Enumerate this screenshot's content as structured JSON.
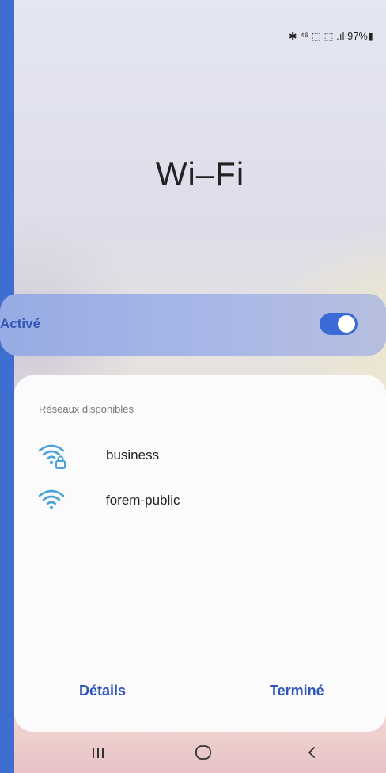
{
  "status_bar": {
    "text": "✱ ⁴⁶ ⬚ ⬚ .ıl 97%▮",
    "battery": "97%"
  },
  "page": {
    "title": "Wi–Fi"
  },
  "wifi_toggle": {
    "label": "Activé",
    "state": "on"
  },
  "networks": {
    "section_title": "Réseaux disponibles",
    "items": [
      {
        "name": "business",
        "icon": "wifi-locked-icon",
        "secured": true
      },
      {
        "name": "forem-public",
        "icon": "wifi-icon",
        "secured": false
      }
    ]
  },
  "actions": {
    "details_label": "Détails",
    "done_label": "Terminé"
  },
  "nav": {
    "recents": "recents-icon",
    "home": "home-icon",
    "back": "back-icon"
  },
  "colors": {
    "accent": "#2f55b9",
    "toggle_on": "#3b69d5",
    "frame": "#3e6fd0",
    "wifi_icon": "#4aa3d8"
  }
}
